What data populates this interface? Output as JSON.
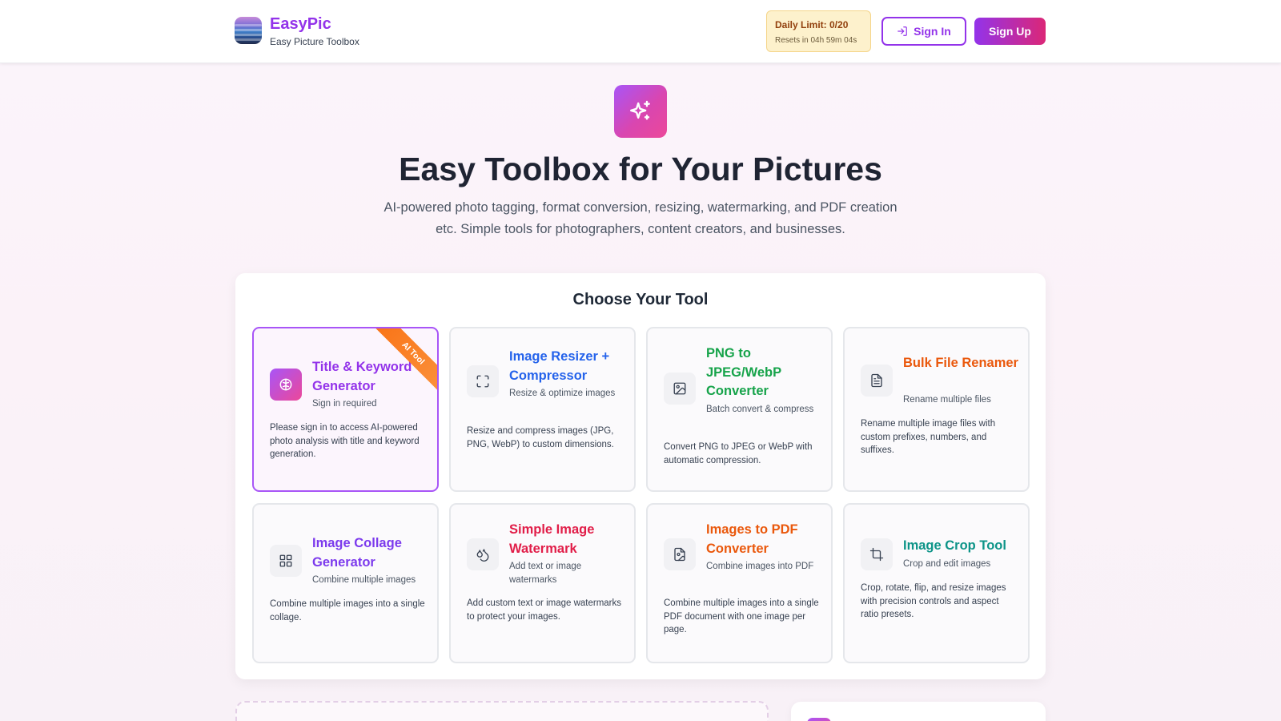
{
  "header": {
    "brand_name": "EasyPic",
    "brand_tagline": "Easy Picture Toolbox",
    "daily_limit": "Daily Limit: 0/20",
    "resets": "Resets in 04h 59m 04s",
    "sign_in": "Sign In",
    "sign_up": "Sign Up"
  },
  "hero": {
    "title": "Easy Toolbox for Your Pictures",
    "description": "AI-powered photo tagging, format conversion, resizing, watermarking, and PDF creation etc. Simple tools for photographers, content creators, and businesses."
  },
  "tools": {
    "heading": "Choose Your Tool",
    "items": [
      {
        "title": "Title & Keyword Generator",
        "subtitle": "Sign in required",
        "description": "Please sign in to access AI-powered photo analysis with title and keyword generation.",
        "badge": "AI Tool",
        "icon": "brain-icon",
        "color": "#9333ea"
      },
      {
        "title": "Image Resizer + Compressor",
        "subtitle": "Resize & optimize images",
        "description": "Resize and compress images (JPG, PNG, WebP) to custom dimensions.",
        "icon": "expand-icon",
        "color": "#2563eb"
      },
      {
        "title": "PNG to JPEG/WebP Converter",
        "subtitle": "Batch convert & compress",
        "description": "Convert PNG to JPEG or WebP with automatic compression.",
        "icon": "image-icon",
        "color": "#16a34a"
      },
      {
        "title": "Bulk File Renamer",
        "subtitle": "Rename multiple files",
        "description": "Rename multiple image files with custom prefixes, numbers, and suffixes.",
        "icon": "file-text-icon",
        "color": "#ea580c"
      },
      {
        "title": "Image Collage Generator",
        "subtitle": "Combine multiple images",
        "description": "Combine multiple images into a single collage.",
        "icon": "grid-icon",
        "color": "#7c3aed"
      },
      {
        "title": "Simple Image Watermark",
        "subtitle": "Add text or image watermarks",
        "description": "Add custom text or image watermarks to protect your images.",
        "icon": "droplets-icon",
        "color": "#e11d48"
      },
      {
        "title": "Images to PDF Converter",
        "subtitle": "Combine images into PDF",
        "description": "Combine multiple images into a single PDF document with one image per page.",
        "icon": "file-image-icon",
        "color": "#ea580c"
      },
      {
        "title": "Image Crop Tool",
        "subtitle": "Crop and edit images",
        "description": "Crop, rotate, flip, and resize images with precision controls and aspect ratio presets.",
        "icon": "crop-icon",
        "color": "#0d9488"
      }
    ]
  }
}
